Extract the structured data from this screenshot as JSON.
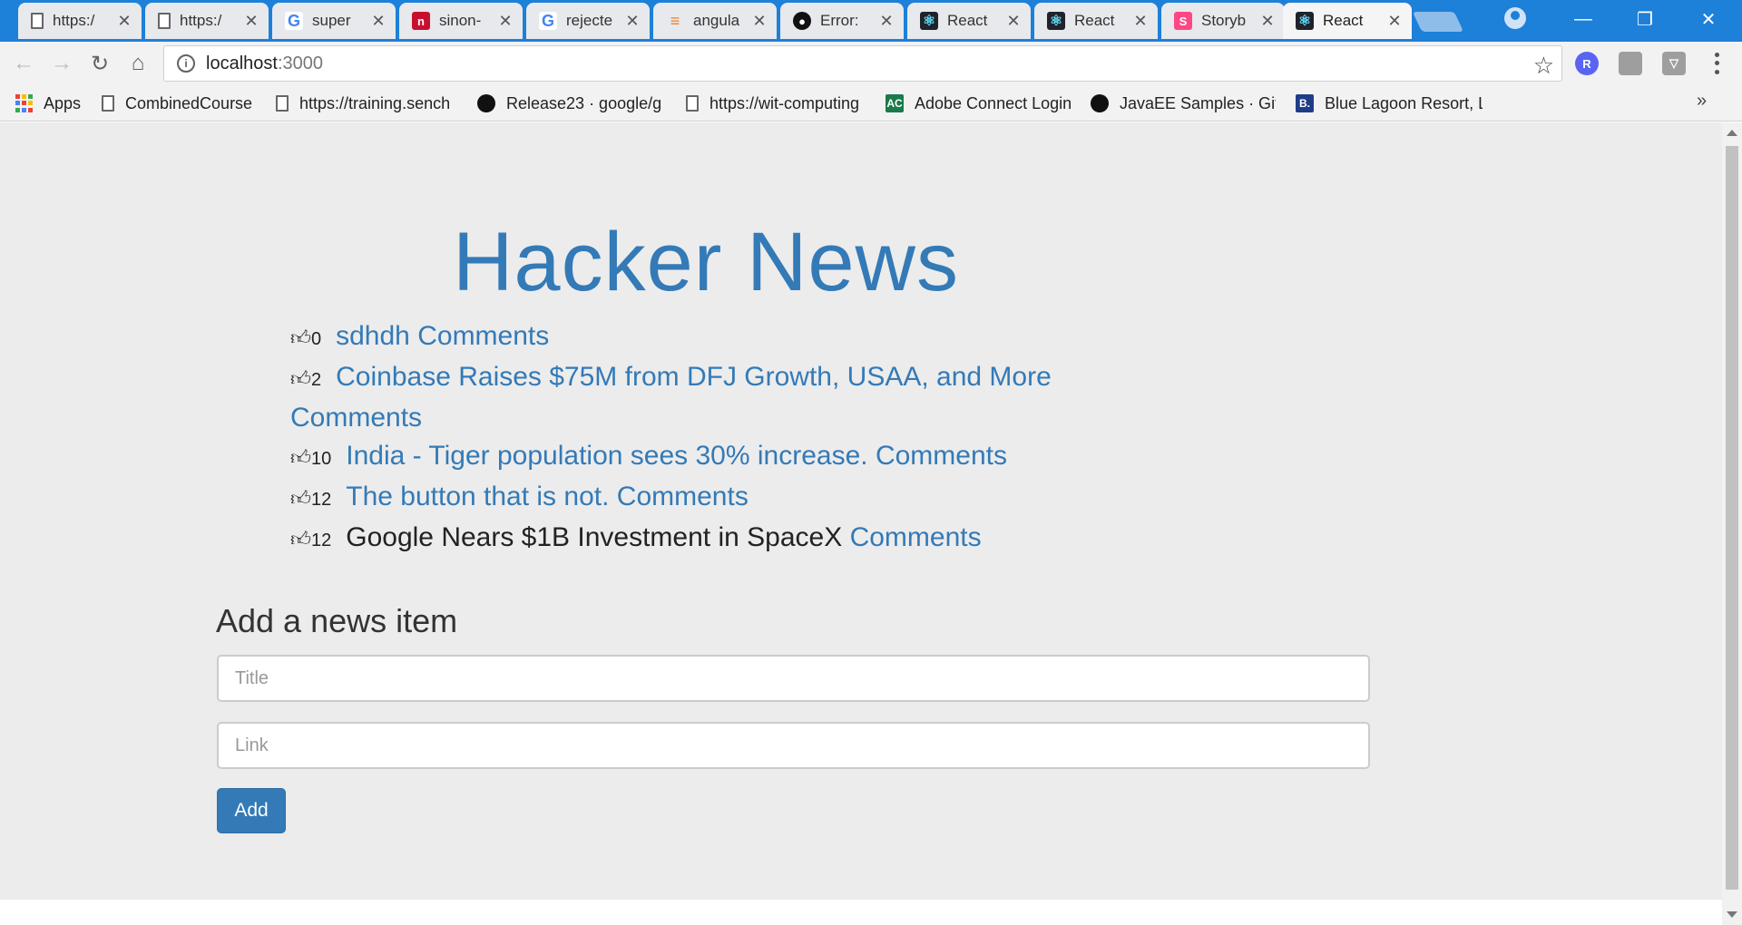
{
  "browser": {
    "tabs": [
      {
        "title": "https:/",
        "favicon": "page-icon"
      },
      {
        "title": "https:/",
        "favicon": "page-icon"
      },
      {
        "title": "super",
        "favicon": "google-icon"
      },
      {
        "title": "sinon-",
        "favicon": "n-icon"
      },
      {
        "title": "rejecte",
        "favicon": "google-icon"
      },
      {
        "title": "angula",
        "favicon": "stackoverflow-icon"
      },
      {
        "title": "Error:",
        "favicon": "github-icon"
      },
      {
        "title": "React",
        "favicon": "react-icon"
      },
      {
        "title": "React",
        "favicon": "react-icon"
      },
      {
        "title": "Storyb",
        "favicon": "storybook-icon"
      },
      {
        "title": "React",
        "favicon": "react-icon",
        "active": true
      }
    ],
    "url": {
      "host": "localhost",
      "port": ":3000"
    },
    "extensions": [
      {
        "name": "extension-r-icon",
        "letter": "R",
        "color": "#5865f2"
      },
      {
        "name": "extension-window-icon",
        "letter": "",
        "color": "#9e9e9e"
      },
      {
        "name": "extension-shield-icon",
        "letter": "",
        "color": "#9e9e9e"
      }
    ],
    "bookmarks": [
      {
        "label": "Apps",
        "icon": "apps-icon"
      },
      {
        "label": "CombinedCourse",
        "icon": "page-icon"
      },
      {
        "label": "https://training.sench",
        "icon": "page-icon"
      },
      {
        "label": "Release23 · google/g",
        "icon": "github-icon"
      },
      {
        "label": "https://wit-computing",
        "icon": "page-icon"
      },
      {
        "label": "Adobe Connect Login",
        "icon": "adobe-connect-icon"
      },
      {
        "label": "JavaEE Samples · GitH",
        "icon": "github-icon"
      },
      {
        "label": "Blue Lagoon Resort, L",
        "icon": "booking-icon"
      }
    ],
    "bookmarks_more": "»"
  },
  "app": {
    "title": "Hacker News",
    "news": [
      {
        "votes": "0",
        "title": "sdhdh",
        "is_link": true,
        "comments": "Comments"
      },
      {
        "votes": "2",
        "title": "Coinbase Raises $75M from DFJ Growth, USAA, and More",
        "is_link": true,
        "comments": "Comments"
      },
      {
        "votes": "10",
        "title": "India - Tiger population sees 30% increase.",
        "is_link": true,
        "comments": "Comments"
      },
      {
        "votes": "12",
        "title": "The button that is not.",
        "is_link": true,
        "comments": "Comments"
      },
      {
        "votes": "12",
        "title": "Google Nears $1B Investment in SpaceX",
        "is_link": false,
        "comments": "Comments"
      }
    ],
    "form": {
      "heading": "Add a news item",
      "title_placeholder": "Title",
      "link_placeholder": "Link",
      "title_value": "",
      "link_value": "",
      "submit_label": "Add"
    },
    "colors": {
      "link": "#337ab7",
      "button": "#337ab7",
      "page_bg": "#ececec"
    }
  }
}
